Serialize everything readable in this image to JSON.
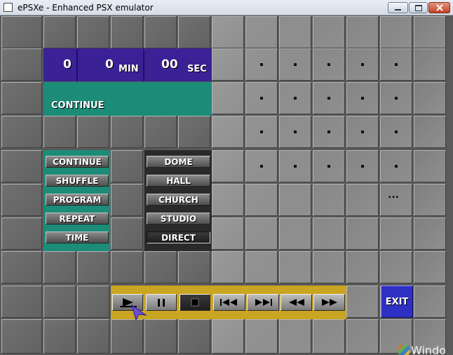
{
  "window": {
    "title": "ePSXe - Enhanced PSX emulator"
  },
  "time_display": {
    "track": "0",
    "minutes": "0",
    "minutes_unit": "MIN",
    "seconds": "00",
    "seconds_unit": "SEC"
  },
  "play_mode": {
    "label": "CONTINUE"
  },
  "mode_options": [
    "CONTINUE",
    "SHUFFLE",
    "PROGRAM",
    "REPEAT",
    "TIME"
  ],
  "sound_options": [
    "DOME",
    "HALL",
    "CHURCH",
    "STUDIO",
    "DIRECT"
  ],
  "sound_selected": "DIRECT",
  "track_grid": {
    "more": "..."
  },
  "transport": [
    "play",
    "pause",
    "stop",
    "previous-track",
    "next-track",
    "rewind",
    "fast-forward"
  ],
  "exit_label": "EXIT",
  "taskbar": {
    "logo_text": "Windo"
  },
  "colors": {
    "time_bg": "#3a2196",
    "mode_bg": "#1c8b78",
    "transport_bg": "#c9a521",
    "exit_bg": "#2e30c4",
    "cursor": "#6b4fd8"
  }
}
